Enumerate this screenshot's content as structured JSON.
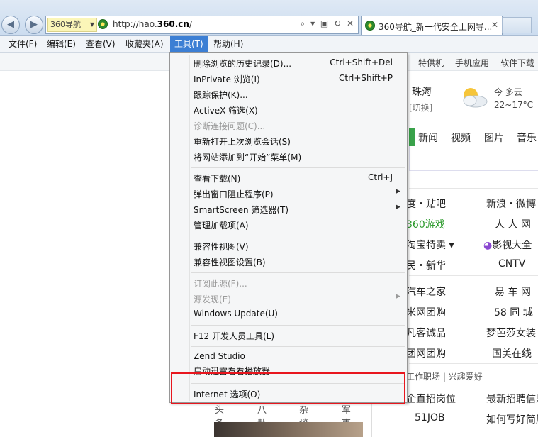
{
  "browser": {
    "nav_badge": "360导航",
    "url_prefix": "http://hao.",
    "url_domain": "360.cn",
    "url_suffix": "/",
    "addr_tools": "⌕ ▾ ▣ ↻ ✕",
    "tab_title": "360导航_新一代安全上网导...",
    "tab_close": "✕",
    "back": "◀",
    "forward": "▶"
  },
  "menubar": [
    {
      "label": "文件(F)"
    },
    {
      "label": "编辑(E)"
    },
    {
      "label": "查看(V)"
    },
    {
      "label": "收藏夹(A)"
    },
    {
      "label": "工具(T)"
    },
    {
      "label": "帮助(H)"
    }
  ],
  "tools_menu": {
    "items": [
      {
        "label": "删除浏览的历史记录(D)...",
        "shortcut": "Ctrl+Shift+Del"
      },
      {
        "label": "InPrivate 浏览(I)",
        "shortcut": "Ctrl+Shift+P"
      },
      {
        "label": "跟踪保护(K)..."
      },
      {
        "label": "ActiveX 筛选(X)"
      },
      {
        "label": "诊断连接问题(C)...",
        "disabled": true
      },
      {
        "label": "重新打开上次浏览会话(S)"
      },
      {
        "label": "将网站添加到“开始”菜单(M)"
      },
      {
        "label": "查看下载(N)",
        "shortcut": "Ctrl+J"
      },
      {
        "label": "弹出窗口阻止程序(P)",
        "submenu": true
      },
      {
        "label": "SmartScreen 筛选器(T)",
        "submenu": true
      },
      {
        "label": "管理加载项(A)"
      },
      {
        "label": "兼容性视图(V)"
      },
      {
        "label": "兼容性视图设置(B)"
      },
      {
        "label": "订阅此源(F)...",
        "disabled": true
      },
      {
        "label": "源发现(E)",
        "disabled": true,
        "submenu": true
      },
      {
        "label": "Windows Update(U)"
      },
      {
        "label": "F12 开发人员工具(L)"
      },
      {
        "label": "Zend Studio"
      },
      {
        "label": "启动迅雷看看播放器"
      },
      {
        "label": "Internet 选项(O)"
      }
    ],
    "submenu_arrow": "▶"
  },
  "page": {
    "top_links": [
      "特供机",
      "手机应用",
      "软件下载"
    ],
    "city": "珠海",
    "city_switch": "[切换]",
    "weather_desc": "今 多云",
    "weather_temp": "22~17°C",
    "search_tabs": [
      "新闻",
      "视频",
      "图片",
      "音乐"
    ],
    "sites": [
      [
        "度・贴吧",
        "新浪・微博"
      ],
      [
        "360游戏",
        "人 人 网"
      ],
      [
        "淘宝特卖 ▾",
        "影视大全"
      ],
      [
        "民・新华",
        "CNTV"
      ],
      [
        "汽车之家",
        "易 车 网"
      ],
      [
        "米网团购",
        "58 同 城"
      ],
      [
        "凡客诚品",
        "梦芭莎女装"
      ],
      [
        "团网团购",
        "国美在线"
      ]
    ],
    "jobs_tabs": "工作职场  |  兴趣爱好",
    "jobs": [
      [
        "企直招岗位",
        "最新招聘信息"
      ],
      [
        "51JOB",
        "如何写好简历"
      ]
    ],
    "news_tabs": [
      "头条",
      "八卦",
      "杂谈",
      "军事"
    ],
    "colors": {
      "accent_green": "#39a24a",
      "highlight_red": "#e8161e",
      "menu_active": "#3c7fd4"
    }
  }
}
